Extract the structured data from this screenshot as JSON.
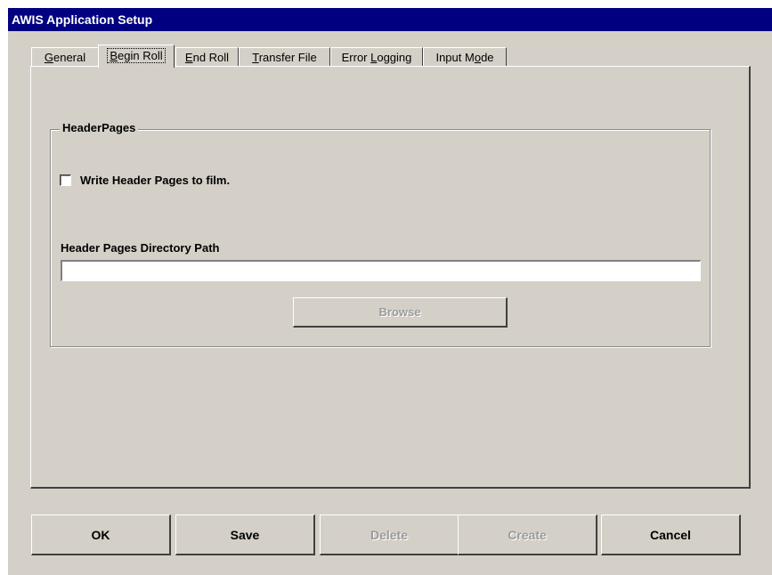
{
  "window": {
    "title": "AWIS Application Setup"
  },
  "tabs": [
    {
      "label": "General",
      "mnemonic": "G",
      "rest": "eneral",
      "active": false
    },
    {
      "label": "Begin Roll",
      "mnemonic": "B",
      "rest": "egin Roll",
      "active": true
    },
    {
      "label": "End Roll",
      "mnemonic": "E",
      "rest": "nd Roll",
      "active": false
    },
    {
      "label": "Transfer File",
      "mnemonic": "T",
      "rest": "ransfer File",
      "active": false
    },
    {
      "label": "Error Logging",
      "pre": "Error ",
      "mnemonic": "L",
      "rest": "ogging",
      "active": false
    },
    {
      "label": "Input Mode",
      "pre": "Input M",
      "mnemonic": "o",
      "rest": "de",
      "active": false
    }
  ],
  "header_pages": {
    "group_title": "HeaderPages",
    "checkbox_label": "Write Header Pages to film.",
    "checkbox_checked": false,
    "path_label": "Header Pages Directory Path",
    "path_value": "",
    "browse_label": "Browse",
    "browse_enabled": false
  },
  "buttons": {
    "ok": {
      "label": "OK",
      "enabled": true
    },
    "save": {
      "label": "Save",
      "enabled": true
    },
    "delete": {
      "label": "Delete",
      "enabled": false
    },
    "create": {
      "label": "Create",
      "enabled": false
    },
    "cancel": {
      "label": "Cancel",
      "enabled": true
    }
  },
  "colors": {
    "titlebar": "#000080",
    "face": "#d4d0c8",
    "disabled_text": "#9a9a9a"
  }
}
